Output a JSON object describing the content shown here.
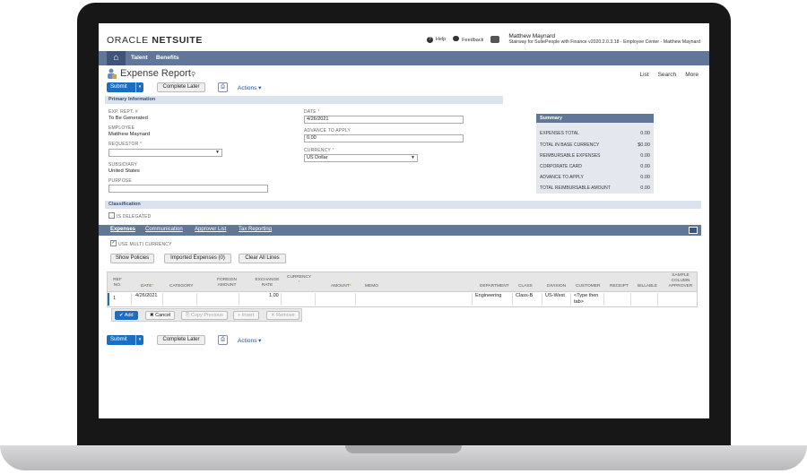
{
  "header": {
    "logo_oracle": "ORACLE",
    "logo_netsuite": "NETSUITE",
    "help": "Help",
    "feedback": "Feedback",
    "user_name": "Matthew Maynard",
    "user_role": "Stairway for SuitePeople with Finance v2020.2.0.3.18 - Employee Center - Matthew Maynard"
  },
  "nav": {
    "items": [
      "Talent",
      "Benefits"
    ]
  },
  "page": {
    "title": "Expense Report",
    "top_links": [
      "List",
      "Search",
      "More"
    ],
    "submit_label": "Submit",
    "complete_later_label": "Complete Later",
    "actions_label": "Actions ▾"
  },
  "primary": {
    "section_title": "Primary Information",
    "exp_rept_label": "EXP. REPT. #",
    "exp_rept_value": "To Be Generated",
    "employee_label": "EMPLOYEE",
    "employee_value": "Matthew Maynard",
    "requestor_label": "REQUESTOR",
    "subsidiary_label": "SUBSIDIARY",
    "subsidiary_value": "United States",
    "purpose_label": "PURPOSE",
    "date_label": "DATE",
    "date_value": "4/26/2021",
    "advance_label": "ADVANCE TO APPLY",
    "advance_value": "0.00",
    "currency_label": "CURRENCY",
    "currency_value": "US Dollar",
    "required_mark": "*"
  },
  "summary": {
    "title": "Summary",
    "rows": [
      {
        "label": "EXPENSES TOTAL",
        "value": "0.00"
      },
      {
        "label": "TOTAL IN BASE CURRENCY",
        "value": "$0.00"
      },
      {
        "label": "REIMBURSABLE EXPENSES",
        "value": "0.00"
      },
      {
        "label": "CORPORATE CARD",
        "value": "0.00"
      },
      {
        "label": "ADVANCE TO APPLY",
        "value": "0.00"
      },
      {
        "label": "TOTAL REIMBURSABLE AMOUNT",
        "value": "0.00"
      }
    ]
  },
  "classification": {
    "section_title": "Classification",
    "is_delegated": "IS DELEGATED"
  },
  "tabs": [
    "Expenses",
    "Communication",
    "Approver List",
    "Tax Reporting"
  ],
  "expenses": {
    "use_multi_currency": "USE MULTI CURRENCY",
    "show_policies": "Show Policies",
    "imported_expenses": "Imported Expenses (0)",
    "clear_all_lines": "Clear All Lines",
    "columns": {
      "ref_no": "REF NO.",
      "date": "DATE",
      "category": "CATEGORY",
      "foreign_amount": "FOREIGN AMOUNT",
      "exchange_rate": "EXCHANGE RATE",
      "currency": "CURRENCY",
      "amount": "AMOUNT",
      "memo": "MEMO",
      "department": "DEPARTMENT",
      "class": "CLASS",
      "division": "DIVISION",
      "customer": "CUSTOMER",
      "receipt": "RECEIPT",
      "billable": "BILLABLE",
      "sample_col": "SAMPLE COLUMN APPROVER"
    },
    "row": {
      "ref_no": "1",
      "date": "4/26/2021",
      "exchange_rate": "1.00",
      "department": "Engineering",
      "class": "Class-B",
      "division": "US-West",
      "customer": "<Type then tab>"
    },
    "line_buttons": {
      "add": "✔ Add",
      "cancel": "✖ Cancel",
      "copy_previous": "⎘ Copy Previous",
      "insert": "+ Insert",
      "remove": "✕ Remove"
    }
  }
}
